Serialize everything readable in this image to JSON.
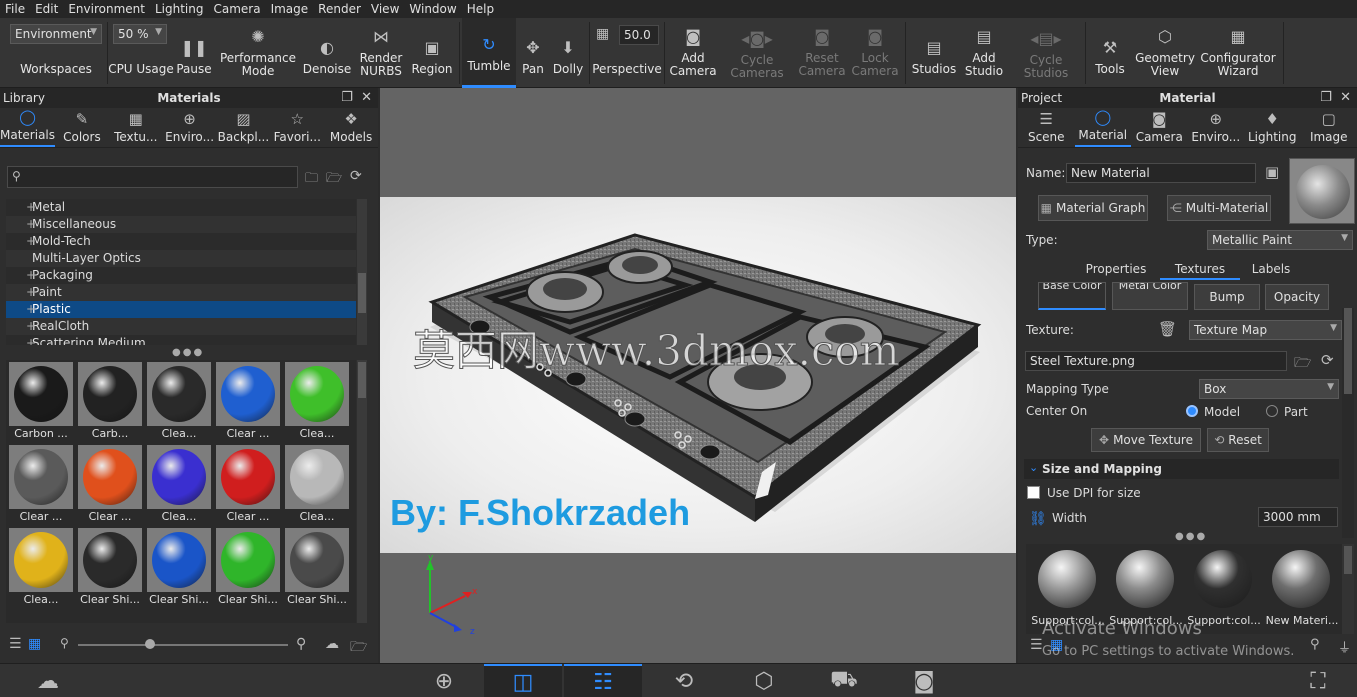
{
  "menu": [
    "File",
    "Edit",
    "Environment",
    "Lighting",
    "Camera",
    "Image",
    "Render",
    "View",
    "Window",
    "Help"
  ],
  "ribbon": {
    "workspace_select": "Environment",
    "workspaces_label": "Workspaces",
    "cpu_select": "50 %",
    "cpu_label": "CPU Usage",
    "pause": "Pause",
    "performance": "Performance\nMode",
    "denoise": "Denoise",
    "render_nurbs": "Render\nNURBS",
    "region": "Region",
    "tumble": "Tumble",
    "pan": "Pan",
    "dolly": "Dolly",
    "perspective_value": "50.0",
    "perspective": "Perspective",
    "add_camera": "Add\nCamera",
    "cycle_cameras": "Cycle\nCameras",
    "reset_camera": "Reset\nCamera",
    "lock_camera": "Lock\nCamera",
    "studios": "Studios",
    "add_studio": "Add\nStudio",
    "cycle_studios": "Cycle\nStudios",
    "tools": "Tools",
    "geometry_view": "Geometry\nView",
    "configurator_wizard": "Configurator\nWizard"
  },
  "library": {
    "header_left": "Library",
    "header_title": "Materials",
    "tabs": [
      "Materials",
      "Colors",
      "Textu...",
      "Enviro...",
      "Backpl...",
      "Favori...",
      "Models"
    ],
    "tree": [
      {
        "label": "Metal",
        "plus": true
      },
      {
        "label": "Miscellaneous",
        "plus": true
      },
      {
        "label": "Mold-Tech",
        "plus": true
      },
      {
        "label": "Multi-Layer Optics",
        "plus": false
      },
      {
        "label": "Packaging",
        "plus": true
      },
      {
        "label": "Paint",
        "plus": true
      },
      {
        "label": "Plastic",
        "plus": true,
        "selected": true
      },
      {
        "label": "RealCloth",
        "plus": true
      },
      {
        "label": "Scattering Medium",
        "plus": true
      }
    ],
    "thumbs": [
      {
        "label": "Carbon ...",
        "color": "#1a1a1a"
      },
      {
        "label": "Carb...",
        "color": "#222222"
      },
      {
        "label": "Clea...",
        "color": "#2a2a2a"
      },
      {
        "label": "Clear ...",
        "color": "#1f5fd0"
      },
      {
        "label": "Clea...",
        "color": "#3fbf2a"
      },
      {
        "label": "Clear ...",
        "color": "#5a5a5a"
      },
      {
        "label": "Clear ...",
        "color": "#e0501c"
      },
      {
        "label": "Clea...",
        "color": "#3a2fd0"
      },
      {
        "label": "Clear ...",
        "color": "#d01e1e"
      },
      {
        "label": "Clea...",
        "color": "#b8b8b8"
      },
      {
        "label": "Clea...",
        "color": "#e0b21a"
      },
      {
        "label": "Clear Shi...",
        "color": "#2a2a2a"
      },
      {
        "label": "Clear Shi...",
        "color": "#1a55c8"
      },
      {
        "label": "Clear Shi...",
        "color": "#2fb52a"
      },
      {
        "label": "Clear Shi...",
        "color": "#4a4a4a"
      }
    ]
  },
  "viewport": {
    "watermark": "莫西网www.3dmox.com",
    "credit": "By: F.Shokrzadeh",
    "axis": {
      "x": "x",
      "y": "y",
      "z": "z"
    }
  },
  "project": {
    "header_left": "Project",
    "header_title": "Material",
    "tabs": [
      "Scene",
      "Material",
      "Camera",
      "Enviro...",
      "Lighting",
      "Image"
    ],
    "name_label": "Name:",
    "name_value": "New Material",
    "material_graph": "Material Graph",
    "multi_material": "Multi-Material",
    "type_label": "Type:",
    "type_value": "Metallic Paint",
    "subtabs": [
      "Properties",
      "Textures",
      "Labels"
    ],
    "texture_tabs": [
      "Base Color",
      "Metal Color",
      "Bump",
      "Opacity"
    ],
    "texture_label": "Texture:",
    "texture_type": "Texture Map",
    "texture_file": "Steel Texture.png",
    "mapping_label": "Mapping Type",
    "mapping_value": "Box",
    "center_label": "Center On",
    "center_model": "Model",
    "center_part": "Part",
    "move_texture": "Move Texture",
    "reset": "Reset",
    "size_section": "Size and Mapping",
    "dpi_label": "Use DPI for size",
    "width_label": "Width",
    "width_value": "3000 mm",
    "thumbs": [
      "Support:col...",
      "Support:col...",
      "Support:col...",
      "New Materi..."
    ]
  },
  "activation": {
    "line1": "Activate Windows",
    "line2": "Go to PC settings to activate Windows."
  }
}
